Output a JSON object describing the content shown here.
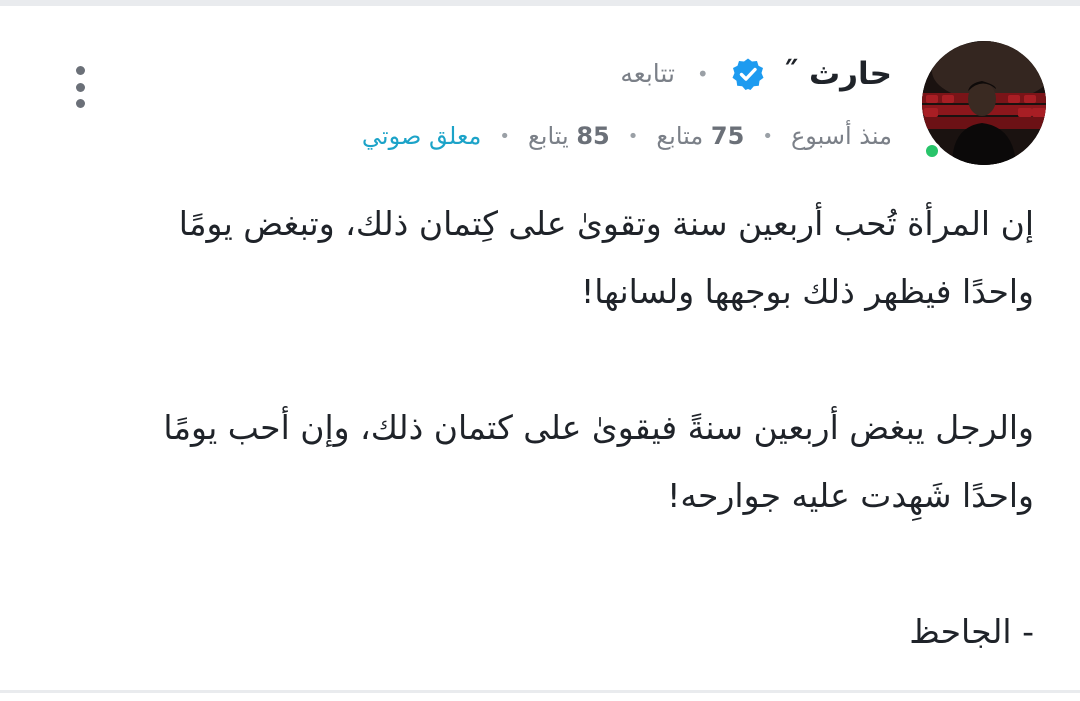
{
  "post": {
    "author": {
      "name": "حارث ˝",
      "verified": true,
      "follow_label": "تتابعه",
      "online": true
    },
    "meta": {
      "time": "منذ أسبوع",
      "followers_count": "75",
      "followers_label": "متابع",
      "following_count": "85",
      "following_label": "يتابع",
      "voice_comment_label": "معلق صوتي"
    },
    "body": {
      "line1": "إن المرأة تُحب أربعين سنة وتقوىٰ على كِتمان ذلك، وتبغض يومًا",
      "line2": "واحدًا فيظهر ذلك بوجهها ولسانها!",
      "line3": "والرجل يبغض أربعين سنةً فيقوىٰ على كتمان ذلك، وإن أحب يومًا",
      "line4": "واحدًا شَهِدت عليه جوارحه!",
      "line5": "- الجاحظ"
    }
  },
  "icons": {
    "verified": "verified-badge-icon",
    "menu": "more-vertical-icon",
    "avatar": "profile-photo"
  },
  "colors": {
    "verified_blue": "#1d9bf0",
    "voice_link": "#1ca3c8",
    "online_green": "#28c46a",
    "muted_text": "#7b8088"
  }
}
